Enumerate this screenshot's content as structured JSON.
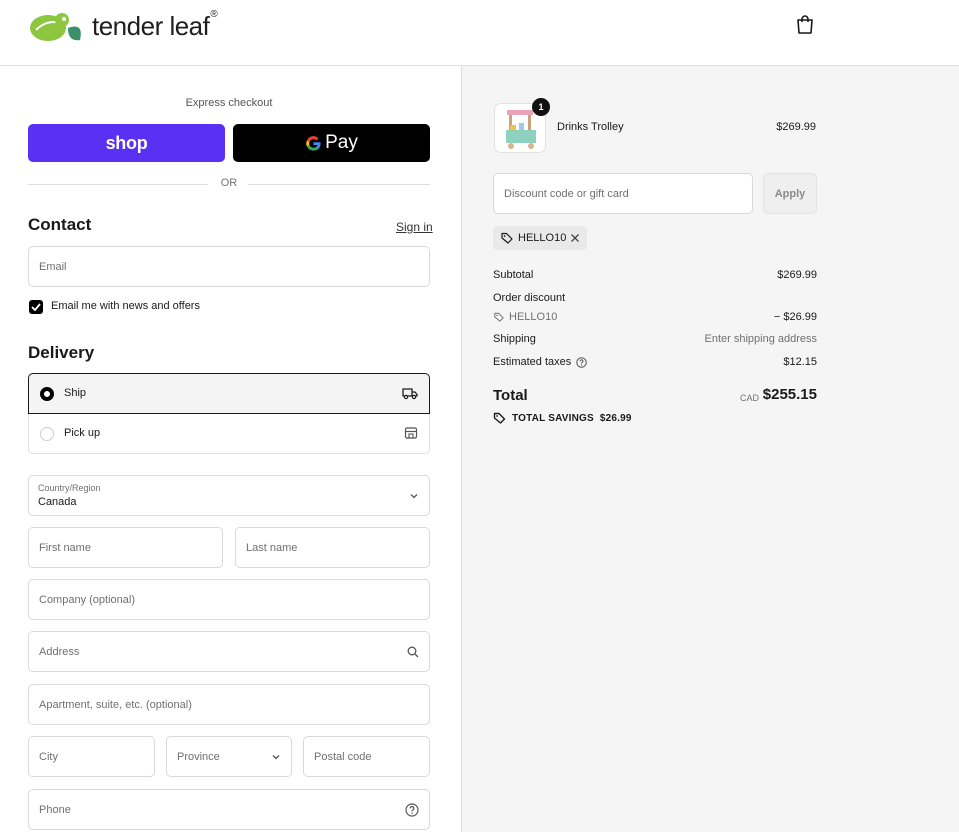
{
  "brand": {
    "name": "tender leaf",
    "reg": "®"
  },
  "express": {
    "label": "Express checkout",
    "shop_label": "shop",
    "gpay_label": "Pay",
    "or_label": "OR"
  },
  "contact": {
    "heading": "Contact",
    "signin_label": "Sign in",
    "email_placeholder": "Email",
    "news_label": "Email me with news and offers",
    "news_checked": true
  },
  "delivery": {
    "heading": "Delivery",
    "options": [
      {
        "label": "Ship",
        "selected": true,
        "icon": "truck-icon"
      },
      {
        "label": "Pick up",
        "selected": false,
        "icon": "store-icon"
      }
    ],
    "country_label": "Country/Region",
    "country_value": "Canada",
    "first_name_placeholder": "First name",
    "last_name_placeholder": "Last name",
    "company_placeholder": "Company (optional)",
    "address_placeholder": "Address",
    "apartment_placeholder": "Apartment, suite, etc. (optional)",
    "city_placeholder": "City",
    "province_placeholder": "Province",
    "postal_placeholder": "Postal code",
    "phone_placeholder": "Phone"
  },
  "order": {
    "item": {
      "name": "Drinks Trolley",
      "price": "$269.99",
      "quantity": "1"
    },
    "discount_placeholder": "Discount code or gift card",
    "apply_label": "Apply",
    "applied_code": "HELLO10",
    "subtotal_label": "Subtotal",
    "subtotal_value": "$269.99",
    "order_discount_label": "Order discount",
    "discount_code_label": "HELLO10",
    "discount_value": "− $26.99",
    "shipping_label": "Shipping",
    "shipping_value": "Enter shipping address",
    "taxes_label": "Estimated taxes",
    "taxes_value": "$12.15",
    "total_label": "Total",
    "total_currency": "CAD",
    "total_value": "$255.15",
    "savings_label": "TOTAL SAVINGS",
    "savings_value": "$26.99"
  },
  "colors": {
    "shop_purple": "#5a31f4",
    "gpay_black": "#000000",
    "logo_green": "#8dc63f",
    "logo_teal": "#3b8f6a",
    "summary_bg": "#f5f5f5"
  }
}
